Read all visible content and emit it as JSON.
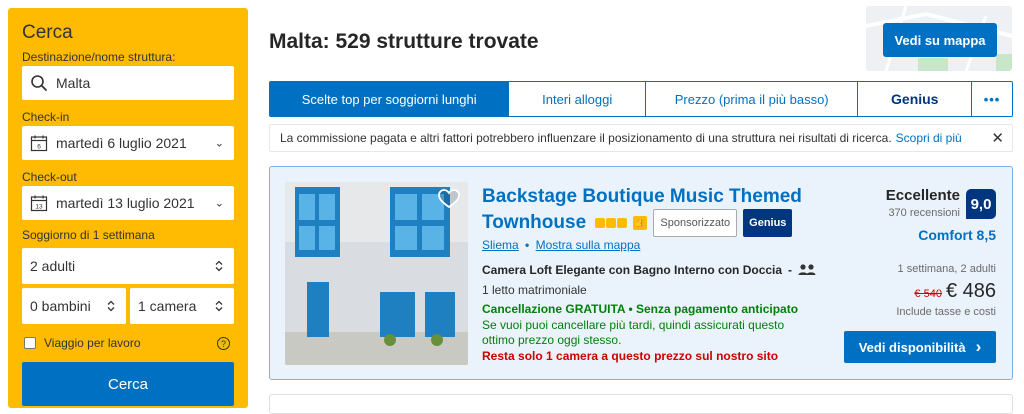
{
  "search": {
    "title": "Cerca",
    "destination_label": "Destinazione/nome struttura:",
    "destination_value": "Malta",
    "checkin_label": "Check-in",
    "checkin_value": "martedì 6 luglio 2021",
    "checkin_day": "6",
    "checkout_label": "Check-out",
    "checkout_value": "martedì 13 luglio 2021",
    "checkout_day": "13",
    "stay_length": "Soggiorno di 1 settimana",
    "adults": "2 adulti",
    "children": "0 bambini",
    "rooms": "1 camera",
    "business_trip": "Viaggio per lavoro",
    "help_icon": "?",
    "button": "Cerca"
  },
  "header": {
    "title": "Malta: 529 strutture trovate",
    "map_button": "Vedi su mappa"
  },
  "tabs": [
    {
      "label": "Scelte top per soggiorni lunghi"
    },
    {
      "label": "Interi alloggi"
    },
    {
      "label": "Prezzo (prima il più basso)"
    },
    {
      "label": "Genius"
    },
    {
      "label": "•••"
    }
  ],
  "notice": {
    "text": "La commissione pagata e altri fattori potrebbero influenzare il posizionamento di una struttura nei risultati di ricerca.",
    "link": "Scopri di più",
    "close": "✕"
  },
  "result": {
    "name": "Backstage Boutique Music Themed Townhouse",
    "sponsored": "Sponsorizzato",
    "genius": "Genius",
    "star_rating": 3,
    "city": "Sliema",
    "separator": "•",
    "map_link": "Mostra sulla mappa",
    "room_type": "Camera Loft Elegante con Bagno Interno con Doccia",
    "room_dash": "-",
    "bed": "1 letto matrimoniale",
    "free_cancel": "Cancellazione GRATUITA • Senza pagamento anticipato",
    "cancel_note": "Se vuoi puoi cancellare più tardi, quindi assicurati questo ottimo prezzo oggi stesso.",
    "last_room": "Resta solo 1 camera a questo prezzo sul nostro sito",
    "review_word": "Eccellente",
    "review_count": "370 recensioni",
    "score": "9,0",
    "comfort": "Comfort 8,5",
    "stay_info": "1 settimana, 2 adulti",
    "old_price": "€ 540",
    "price": "€ 486",
    "taxes": "Include tasse e costi",
    "button": "Vedi disponibilità",
    "button_chevron": "›"
  },
  "colors": {
    "brand_yellow": "#febb02",
    "brand_blue": "#0071c2",
    "dark_blue": "#003580",
    "green": "#008009",
    "red": "#cc0000"
  }
}
